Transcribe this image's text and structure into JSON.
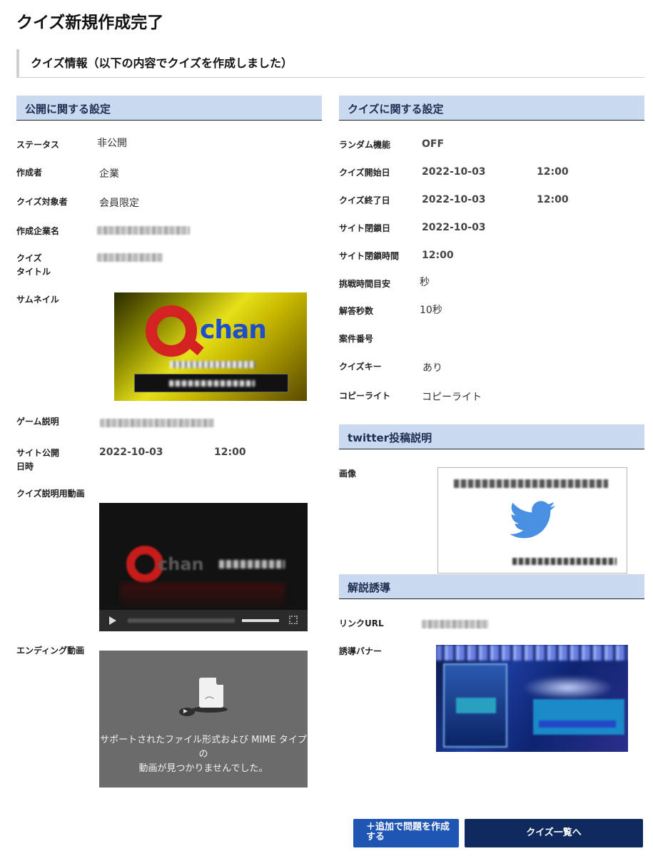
{
  "page": {
    "title": "クイズ新規作成完了",
    "info_heading": "クイズ情報（以下の内容でクイズを作成しました）"
  },
  "public_settings": {
    "heading": "公開に関する設定",
    "status_label": "ステータス",
    "status_value": "非公開",
    "creator_label": "作成者",
    "creator_value": "企業",
    "audience_label": "クイズ対象者",
    "audience_value": "会員限定",
    "company_label": "作成企業名",
    "quiz_title_label_1": "クイズ",
    "quiz_title_label_2": "タイトル",
    "thumbnail_label": "サムネイル",
    "thumbnail_logo_text": "chan",
    "game_desc_label": "ゲーム説明",
    "publish_label_1": "サイト公開",
    "publish_label_2": "日時",
    "publish_date": "2022-10-03",
    "publish_time": "12:00",
    "explain_video_label": "クイズ説明用動画",
    "explain_video_logo_text": "chan",
    "ending_video_label": "エンディング動画",
    "ending_video_error_1": "サポートされたファイル形式および MIME タイプの",
    "ending_video_error_2": "動画が見つかりませんでした。"
  },
  "quiz_settings": {
    "heading": "クイズに関する設定",
    "random_label": "ランダム機能",
    "random_value": "OFF",
    "start_label": "クイズ開始日",
    "start_date": "2022-10-03",
    "start_time": "12:00",
    "end_label": "クイズ終了日",
    "end_date": "2022-10-03",
    "end_time": "12:00",
    "close_date_label": "サイト閉鎖日",
    "close_date_value": "2022-10-03",
    "close_time_label": "サイト閉鎖時間",
    "close_time_value": "12:00",
    "challenge_time_label": "挑戦時間目安",
    "challenge_time_value": "秒",
    "answer_seconds_label": "解答秒数",
    "answer_seconds_value": "10秒",
    "case_number_label": "案件番号",
    "quiz_key_label": "クイズキー",
    "quiz_key_value": "あり",
    "copyright_label": "コピーライト",
    "copyright_value": "コピーライト"
  },
  "twitter": {
    "heading": "twitter投稿説明",
    "image_label": "画像"
  },
  "guide": {
    "heading": "解説誘導",
    "link_label": "リンクURL",
    "banner_label": "誘導バナー"
  },
  "actions": {
    "add_questions": "＋追加で問題を作成する",
    "quiz_list": "クイズ一覧へ"
  },
  "colors": {
    "section_header_bg": "#c9d9ef",
    "primary_button": "#1f56b4",
    "dark_button": "#0f2a5e",
    "twitter_blue": "#4a90e2"
  }
}
